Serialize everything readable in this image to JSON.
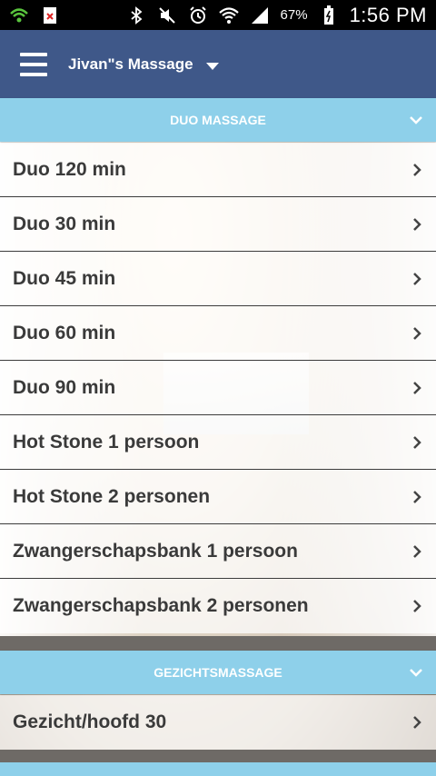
{
  "status_bar": {
    "battery_percent": "67%",
    "time": "1:56 PM",
    "icons": [
      "wifi-hotspot-icon",
      "app-notification-icon",
      "bluetooth-icon",
      "mute-icon",
      "alarm-icon",
      "wifi-icon",
      "signal-icon",
      "battery-icon"
    ]
  },
  "app_bar": {
    "title": "Jivan\"s Massage"
  },
  "sections": [
    {
      "header": "DUO MASSAGE",
      "items": [
        {
          "label": "Duo 120 min"
        },
        {
          "label": "Duo 30 min"
        },
        {
          "label": "Duo 45 min"
        },
        {
          "label": "Duo 60 min"
        },
        {
          "label": "Duo 90 min"
        },
        {
          "label": "Hot Stone 1 persoon"
        },
        {
          "label": "Hot Stone 2 personen"
        },
        {
          "label": "Zwangerschapsbank 1 persoon"
        },
        {
          "label": "Zwangerschapsbank 2 personen"
        }
      ]
    },
    {
      "header": "GEZICHTSMASSAGE",
      "items": [
        {
          "label": "Gezicht/hoofd 30"
        }
      ]
    }
  ],
  "colors": {
    "app_bar": "#3f5889",
    "section_header": "#8ed0ea",
    "row_text": "#3a3a3a"
  }
}
